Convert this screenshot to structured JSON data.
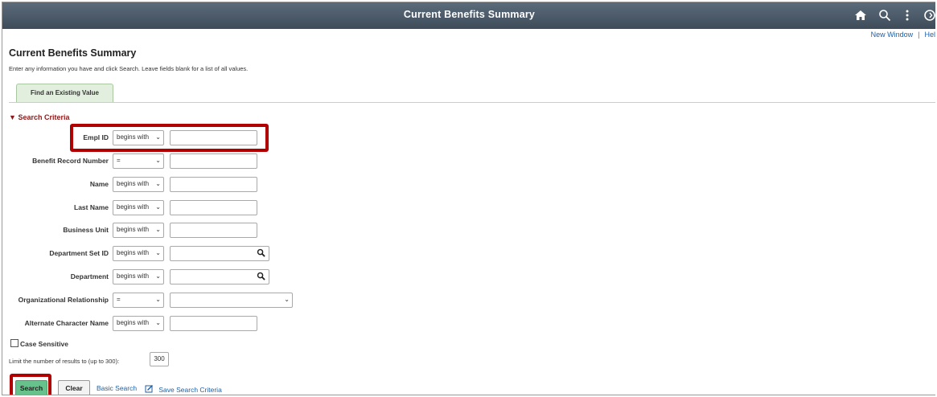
{
  "banner": {
    "title": "Current Benefits Summary"
  },
  "sublinks": {
    "new_window": "New Window",
    "separator": "|",
    "help": "Hel"
  },
  "page": {
    "title": "Current Benefits Summary",
    "instructions": "Enter any information you have and click Search. Leave fields blank for a list of all values."
  },
  "tab": {
    "label": "Find an Existing Value"
  },
  "section": {
    "title": "Search Criteria"
  },
  "criteria": [
    {
      "label": "Empl ID",
      "operator": "begins with",
      "value": ""
    },
    {
      "label": "Benefit Record Number",
      "operator": "=",
      "value": ""
    },
    {
      "label": "Name",
      "operator": "begins with",
      "value": ""
    },
    {
      "label": "Last Name",
      "operator": "begins with",
      "value": ""
    },
    {
      "label": "Business Unit",
      "operator": "begins with",
      "value": ""
    },
    {
      "label": "Department Set ID",
      "operator": "begins with",
      "value": ""
    },
    {
      "label": "Department",
      "operator": "begins with",
      "value": ""
    },
    {
      "label": "Organizational Relationship",
      "operator": "=",
      "value": ""
    },
    {
      "label": "Alternate Character Name",
      "operator": "begins with",
      "value": ""
    }
  ],
  "case_sensitive": {
    "label": "Case Sensitive",
    "checked": false
  },
  "limit": {
    "label": "Limit the number of results to (up to 300):",
    "value": "300"
  },
  "buttons": {
    "search": "Search",
    "clear": "Clear"
  },
  "links": {
    "basic_search": "Basic Search",
    "save_search": "Save Search Criteria"
  },
  "colors": {
    "banner": "#4a5968",
    "highlight": "#b00000",
    "search_button": "#67c18a",
    "link": "#1f5fa6",
    "section_head": "#8b1a1a"
  }
}
